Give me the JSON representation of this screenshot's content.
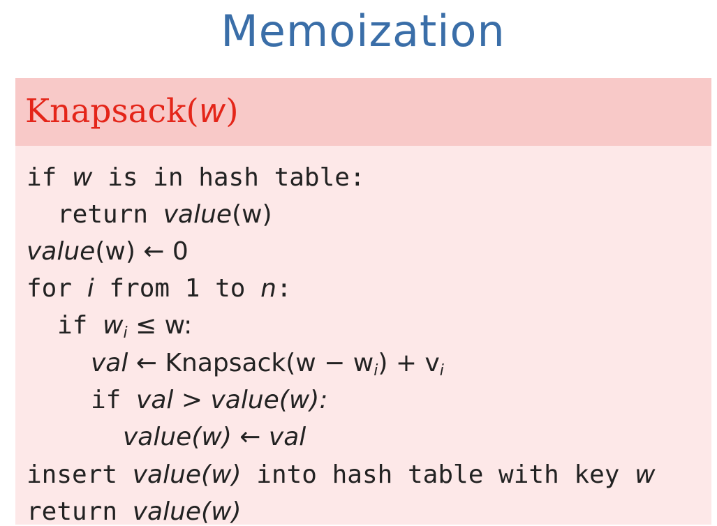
{
  "slide_title": "Memoization",
  "block": {
    "title": "Knapsack(",
    "title_var": "w",
    "title_close": ")"
  },
  "code": {
    "l1_kw": "if ",
    "l1_var": "w",
    "l1_rest": " is in hash table:",
    "l2_kw": "return ",
    "l2_fn": "value",
    "l2_arg": "(w)",
    "l3_fn": "value",
    "l3_rest": "(w) ← 0",
    "l4_kw": "for ",
    "l4_var": "i",
    "l4_mid": " from 1 to ",
    "l4_n": "n",
    "l4_end": ":",
    "l5_kw": "if ",
    "l5_w": "w",
    "l5_sub": "i",
    "l5_rest": " ≤ w:",
    "l6_val": "val",
    "l6_arrow": " ← ",
    "l6_fn": "Knapsack",
    "l6_args": "(w − w",
    "l6_sub": "i",
    "l6_plus": ") + v",
    "l6_sub2": "i",
    "l7_kw": "if ",
    "l7_expr": "val > value(w):",
    "l8_expr": "value(w) ← val",
    "l9_kw1": "insert ",
    "l9_expr": "value(w)",
    "l9_rest": " into hash table with key ",
    "l9_var": "w",
    "l10_kw": "return ",
    "l10_expr": "value(w)"
  }
}
